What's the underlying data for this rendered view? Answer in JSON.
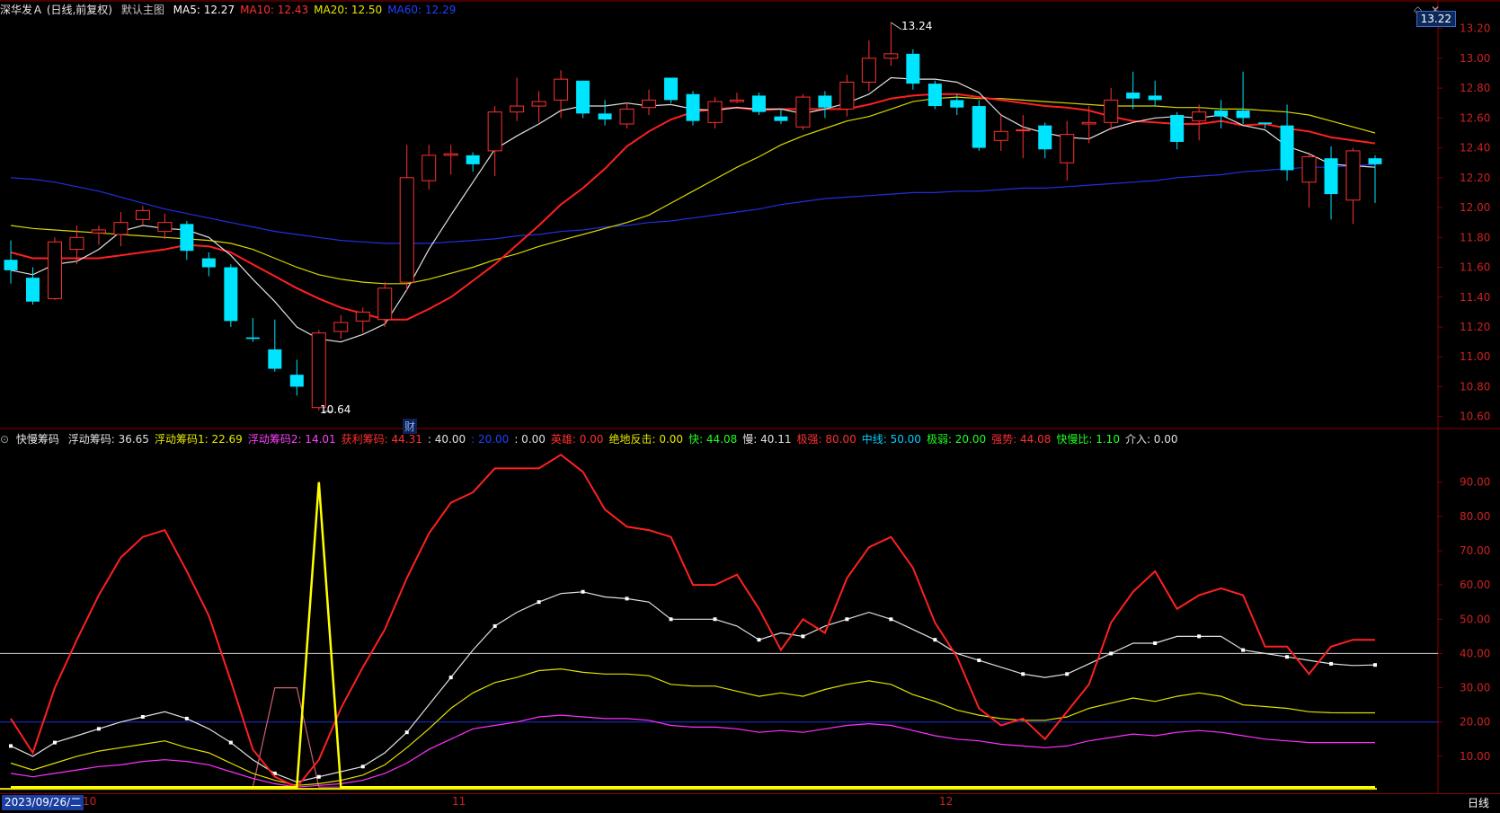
{
  "main_header": {
    "symbol": "深华发Ａ (日线,前复权)",
    "view": "默认主图",
    "ma": [
      {
        "label": "MA5: 12.27",
        "color": "#ffffff"
      },
      {
        "label": "MA10: 12.43",
        "color": "#ff3030"
      },
      {
        "label": "MA20: 12.50",
        "color": "#e8e800"
      },
      {
        "label": "MA60: 12.29",
        "color": "#2040ff"
      }
    ]
  },
  "price_tag": "13.22",
  "high_label": "13.24",
  "low_label": "10.64",
  "cai_mark": "财",
  "price_axis": [
    "13.20",
    "13.00",
    "12.80",
    "12.60",
    "12.40",
    "12.20",
    "12.00",
    "11.80",
    "11.60",
    "11.40",
    "11.20",
    "11.00",
    "10.80",
    "10.60"
  ],
  "indicator_header": {
    "name": "快慢筹码",
    "items": [
      {
        "label": "浮动筹码: 36.65",
        "color": "#e0e0e0"
      },
      {
        "label": "浮动筹码1: 22.69",
        "color": "#e8e800"
      },
      {
        "label": "浮动筹码2: 14.01",
        "color": "#ff40ff"
      },
      {
        "label": "获利筹码: 44.31",
        "color": "#ff3030"
      },
      {
        "label": ": 40.00",
        "color": "#e0e0e0"
      },
      {
        "label": ": 20.00",
        "color": "#2040ff"
      },
      {
        "label": ": 0.00",
        "color": "#e0e0e0"
      },
      {
        "label": "英雄: 0.00",
        "color": "#ff3030"
      },
      {
        "label": "绝地反击: 0.00",
        "color": "#e8e800"
      },
      {
        "label": "快: 44.08",
        "color": "#20ff20"
      },
      {
        "label": "慢: 40.11",
        "color": "#e0e0e0"
      },
      {
        "label": "极强: 80.00",
        "color": "#ff3030"
      },
      {
        "label": "中线: 50.00",
        "color": "#00d0ff"
      },
      {
        "label": "极弱: 20.00",
        "color": "#20ff20"
      },
      {
        "label": "强势: 44.08",
        "color": "#ff3030"
      },
      {
        "label": "快慢比: 1.10",
        "color": "#20ff20"
      },
      {
        "label": "介入: 0.00",
        "color": "#e0e0e0"
      }
    ]
  },
  "indicator_axis": [
    "90.00",
    "80.00",
    "70.00",
    "60.00",
    "50.00",
    "40.00",
    "30.00",
    "20.00",
    "10.00"
  ],
  "footer": {
    "date": "2023/09/26/二",
    "months": [
      "10",
      "11",
      "12"
    ],
    "period": "日线"
  },
  "chart_data": {
    "type": "candlestick",
    "price_range": [
      10.55,
      13.27
    ],
    "candles": [
      [
        11.65,
        11.58,
        11.78,
        11.49
      ],
      [
        11.53,
        11.37,
        11.6,
        11.35
      ],
      [
        11.39,
        11.77,
        11.8,
        11.38
      ],
      [
        11.72,
        11.8,
        11.88,
        11.62
      ],
      [
        11.83,
        11.85,
        11.88,
        11.75
      ],
      [
        11.82,
        11.9,
        11.97,
        11.74
      ],
      [
        11.92,
        11.98,
        12.01,
        11.88
      ],
      [
        11.84,
        11.9,
        11.96,
        11.79
      ],
      [
        11.89,
        11.71,
        11.91,
        11.65
      ],
      [
        11.66,
        11.6,
        11.7,
        11.54
      ],
      [
        11.6,
        11.24,
        11.62,
        11.2
      ],
      [
        11.13,
        11.12,
        11.26,
        11.1
      ],
      [
        11.05,
        10.92,
        11.25,
        10.9
      ],
      [
        10.88,
        10.8,
        10.98,
        10.74
      ],
      [
        10.66,
        11.16,
        11.18,
        10.64
      ],
      [
        11.17,
        11.23,
        11.28,
        11.12
      ],
      [
        11.24,
        11.3,
        11.33,
        11.16
      ],
      [
        11.25,
        11.46,
        11.5,
        11.2
      ],
      [
        11.5,
        12.2,
        12.42,
        11.44
      ],
      [
        12.18,
        12.35,
        12.42,
        12.12
      ],
      [
        12.35,
        12.36,
        12.42,
        12.22
      ],
      [
        12.35,
        12.29,
        12.37,
        12.24
      ],
      [
        12.38,
        12.64,
        12.68,
        12.21
      ],
      [
        12.64,
        12.68,
        12.87,
        12.58
      ],
      [
        12.68,
        12.71,
        12.78,
        12.57
      ],
      [
        12.72,
        12.86,
        12.92,
        12.6
      ],
      [
        12.85,
        12.63,
        12.85,
        12.6
      ],
      [
        12.63,
        12.59,
        12.72,
        12.55
      ],
      [
        12.56,
        12.66,
        12.7,
        12.53
      ],
      [
        12.67,
        12.72,
        12.79,
        12.62
      ],
      [
        12.87,
        12.72,
        12.87,
        12.7
      ],
      [
        12.76,
        12.58,
        12.78,
        12.55
      ],
      [
        12.57,
        12.71,
        12.74,
        12.53
      ],
      [
        12.71,
        12.72,
        12.77,
        12.7
      ],
      [
        12.75,
        12.64,
        12.77,
        12.62
      ],
      [
        12.61,
        12.58,
        12.66,
        12.56
      ],
      [
        12.54,
        12.74,
        12.76,
        12.52
      ],
      [
        12.75,
        12.67,
        12.78,
        12.6
      ],
      [
        12.66,
        12.84,
        12.89,
        12.61
      ],
      [
        12.84,
        13.0,
        13.12,
        12.78
      ],
      [
        13.0,
        13.03,
        13.24,
        12.95
      ],
      [
        13.03,
        12.83,
        13.06,
        12.79
      ],
      [
        12.83,
        12.68,
        12.85,
        12.66
      ],
      [
        12.72,
        12.67,
        12.76,
        12.62
      ],
      [
        12.68,
        12.4,
        12.72,
        12.38
      ],
      [
        12.45,
        12.51,
        12.62,
        12.38
      ],
      [
        12.52,
        12.52,
        12.62,
        12.33
      ],
      [
        12.55,
        12.39,
        12.57,
        12.33
      ],
      [
        12.3,
        12.49,
        12.58,
        12.18
      ],
      [
        12.56,
        12.57,
        12.68,
        12.43
      ],
      [
        12.57,
        12.72,
        12.8,
        12.52
      ],
      [
        12.77,
        12.73,
        12.91,
        12.66
      ],
      [
        12.75,
        12.72,
        12.85,
        12.68
      ],
      [
        12.62,
        12.44,
        12.64,
        12.39
      ],
      [
        12.58,
        12.64,
        12.69,
        12.45
      ],
      [
        12.65,
        12.61,
        12.72,
        12.53
      ],
      [
        12.65,
        12.6,
        12.91,
        12.56
      ],
      [
        12.57,
        12.56,
        12.57,
        12.53
      ],
      [
        12.55,
        12.25,
        12.69,
        12.18
      ],
      [
        12.17,
        12.34,
        12.37,
        12.0
      ],
      [
        12.33,
        12.09,
        12.41,
        11.92
      ],
      [
        12.05,
        12.38,
        12.4,
        11.89
      ],
      [
        12.33,
        12.29,
        12.35,
        12.03
      ]
    ],
    "ma5": [
      11.58,
      11.55,
      11.62,
      11.64,
      11.72,
      11.84,
      11.88,
      11.86,
      11.85,
      11.8,
      11.68,
      11.52,
      11.37,
      11.2,
      11.12,
      11.1,
      11.15,
      11.22,
      11.45,
      11.72,
      11.95,
      12.17,
      12.39,
      12.48,
      12.56,
      12.65,
      12.68,
      12.68,
      12.7,
      12.68,
      12.69,
      12.66,
      12.65,
      12.67,
      12.66,
      12.66,
      12.63,
      12.66,
      12.7,
      12.76,
      12.87,
      12.86,
      12.86,
      12.84,
      12.77,
      12.62,
      12.54,
      12.5,
      12.47,
      12.46,
      12.53,
      12.57,
      12.6,
      12.61,
      12.6,
      12.62,
      12.55,
      12.52,
      12.41,
      12.36,
      12.29,
      12.28,
      12.27
    ],
    "ma10": [
      11.7,
      11.66,
      11.66,
      11.66,
      11.66,
      11.68,
      11.7,
      11.72,
      11.75,
      11.74,
      11.7,
      11.62,
      11.54,
      11.46,
      11.39,
      11.33,
      11.29,
      11.25,
      11.25,
      11.32,
      11.4,
      11.51,
      11.62,
      11.75,
      11.88,
      12.02,
      12.13,
      12.26,
      12.41,
      12.51,
      12.59,
      12.64,
      12.66,
      12.67,
      12.65,
      12.66,
      12.66,
      12.66,
      12.66,
      12.69,
      12.73,
      12.75,
      12.76,
      12.76,
      12.74,
      12.72,
      12.7,
      12.68,
      12.67,
      12.65,
      12.61,
      12.58,
      12.57,
      12.56,
      12.56,
      12.58,
      12.55,
      12.56,
      12.53,
      12.51,
      12.47,
      12.45,
      12.43
    ],
    "ma20": [
      11.88,
      11.86,
      11.85,
      11.84,
      11.83,
      11.82,
      11.81,
      11.8,
      11.79,
      11.78,
      11.76,
      11.72,
      11.66,
      11.6,
      11.55,
      11.52,
      11.5,
      11.49,
      11.49,
      11.52,
      11.56,
      11.6,
      11.65,
      11.69,
      11.74,
      11.78,
      11.82,
      11.86,
      11.9,
      11.95,
      12.03,
      12.11,
      12.19,
      12.27,
      12.34,
      12.42,
      12.48,
      12.53,
      12.58,
      12.61,
      12.66,
      12.71,
      12.73,
      12.74,
      12.73,
      12.73,
      12.72,
      12.71,
      12.7,
      12.69,
      12.68,
      12.68,
      12.68,
      12.67,
      12.67,
      12.66,
      12.66,
      12.65,
      12.64,
      12.62,
      12.58,
      12.54,
      12.5
    ],
    "ma60": [
      12.2,
      12.19,
      12.17,
      12.14,
      12.11,
      12.07,
      12.03,
      11.99,
      11.96,
      11.93,
      11.9,
      11.87,
      11.84,
      11.82,
      11.8,
      11.78,
      11.77,
      11.76,
      11.76,
      11.76,
      11.77,
      11.78,
      11.79,
      11.81,
      11.82,
      11.84,
      11.85,
      11.87,
      11.88,
      11.9,
      11.91,
      11.93,
      11.95,
      11.97,
      11.99,
      12.02,
      12.04,
      12.06,
      12.07,
      12.08,
      12.09,
      12.1,
      12.1,
      12.11,
      12.11,
      12.12,
      12.13,
      12.13,
      12.14,
      12.15,
      12.16,
      12.17,
      12.18,
      12.2,
      12.21,
      12.22,
      12.24,
      12.25,
      12.26,
      12.27,
      12.27,
      12.28,
      12.29
    ],
    "indicator": {
      "range": [
        0,
        97
      ],
      "profit_red": [
        21,
        11,
        30,
        44,
        57,
        68,
        74,
        76,
        64,
        51,
        32,
        12,
        4,
        1,
        9,
        24,
        36,
        47,
        62,
        75,
        84,
        87,
        94,
        94,
        94,
        98,
        93,
        82,
        77,
        76,
        74,
        60,
        60,
        63,
        53,
        41,
        50,
        46,
        62,
        71,
        74,
        65,
        49,
        39,
        24,
        19,
        21,
        15,
        23,
        31,
        49,
        58,
        64,
        53,
        57,
        59,
        57,
        42,
        42,
        34,
        42,
        44,
        44
      ],
      "float_white": [
        13,
        10,
        14,
        16,
        18,
        20,
        21.5,
        23,
        21,
        18,
        14,
        9,
        5,
        2.5,
        4,
        5.5,
        7,
        11,
        17,
        25,
        33,
        41,
        48,
        52,
        55,
        57.5,
        58,
        56.5,
        56,
        55,
        50,
        50,
        50,
        48,
        44,
        46,
        45,
        48,
        50,
        52,
        50,
        47,
        44,
        40,
        38,
        36,
        34,
        33,
        34,
        37,
        40,
        43,
        43,
        45,
        45,
        45,
        41,
        40,
        39,
        38,
        37,
        36.5,
        36.65
      ],
      "float1_yellow": [
        8,
        6,
        8,
        10,
        11.5,
        12.5,
        13.5,
        14.5,
        12.5,
        11,
        8,
        5,
        3,
        1.5,
        2,
        3,
        4.5,
        7.5,
        12.5,
        18,
        24,
        28.5,
        31.5,
        33,
        35,
        35.5,
        34.5,
        34,
        34,
        33.5,
        31,
        30.5,
        30.5,
        29,
        27.5,
        28.5,
        27.5,
        29.5,
        31,
        32,
        31,
        28,
        26,
        23.5,
        22,
        21,
        20.5,
        20.5,
        21.5,
        24,
        25.5,
        27,
        26,
        27.5,
        28.5,
        27.5,
        25,
        24.5,
        24,
        23,
        22.7,
        22.69,
        22.69
      ],
      "float2_magenta": [
        5,
        4,
        5,
        6,
        7,
        7.5,
        8.5,
        9,
        8.5,
        7.5,
        5.5,
        3.5,
        2,
        1,
        1.5,
        2,
        3,
        5,
        8,
        12,
        15,
        18,
        19,
        20,
        21.5,
        22,
        21.5,
        21,
        21,
        20.5,
        19,
        18.5,
        18.5,
        18,
        17,
        17.5,
        17,
        18,
        19,
        19.5,
        19,
        17.5,
        16,
        15,
        14.5,
        13.5,
        13,
        12.5,
        13,
        14.5,
        15.5,
        16.5,
        16,
        17,
        17.5,
        17,
        16,
        15,
        14.5,
        14,
        14,
        14.01,
        14.01
      ],
      "spike_yellow": [
        1,
        1,
        1,
        1,
        1,
        1,
        1,
        1,
        1,
        1,
        1,
        1,
        1,
        1,
        90,
        1,
        1,
        1,
        1,
        1,
        1,
        1,
        1,
        1,
        1,
        1,
        1,
        1,
        1,
        1,
        1,
        1,
        1,
        1,
        1,
        1,
        1,
        1,
        1,
        1,
        1,
        1,
        1,
        1,
        1,
        1,
        1,
        1,
        1,
        1,
        1,
        1,
        1,
        1,
        1,
        1,
        1,
        1,
        1,
        1,
        1,
        1,
        1
      ],
      "spike_pink": [
        1,
        1,
        1,
        1,
        1,
        1,
        1,
        1,
        1,
        1,
        1,
        1,
        30,
        30,
        1,
        1,
        1,
        1,
        1,
        1,
        1,
        1,
        1,
        1,
        1,
        1,
        1,
        1,
        1,
        1,
        1,
        1,
        1,
        1,
        1,
        1,
        1,
        1,
        1,
        1,
        1,
        1,
        1,
        1,
        1,
        1,
        1,
        1,
        1,
        1,
        1,
        1,
        1,
        1,
        1,
        1,
        1,
        1,
        1,
        1,
        1,
        1,
        1
      ],
      "level_white": 40,
      "level_blue": 20
    }
  }
}
